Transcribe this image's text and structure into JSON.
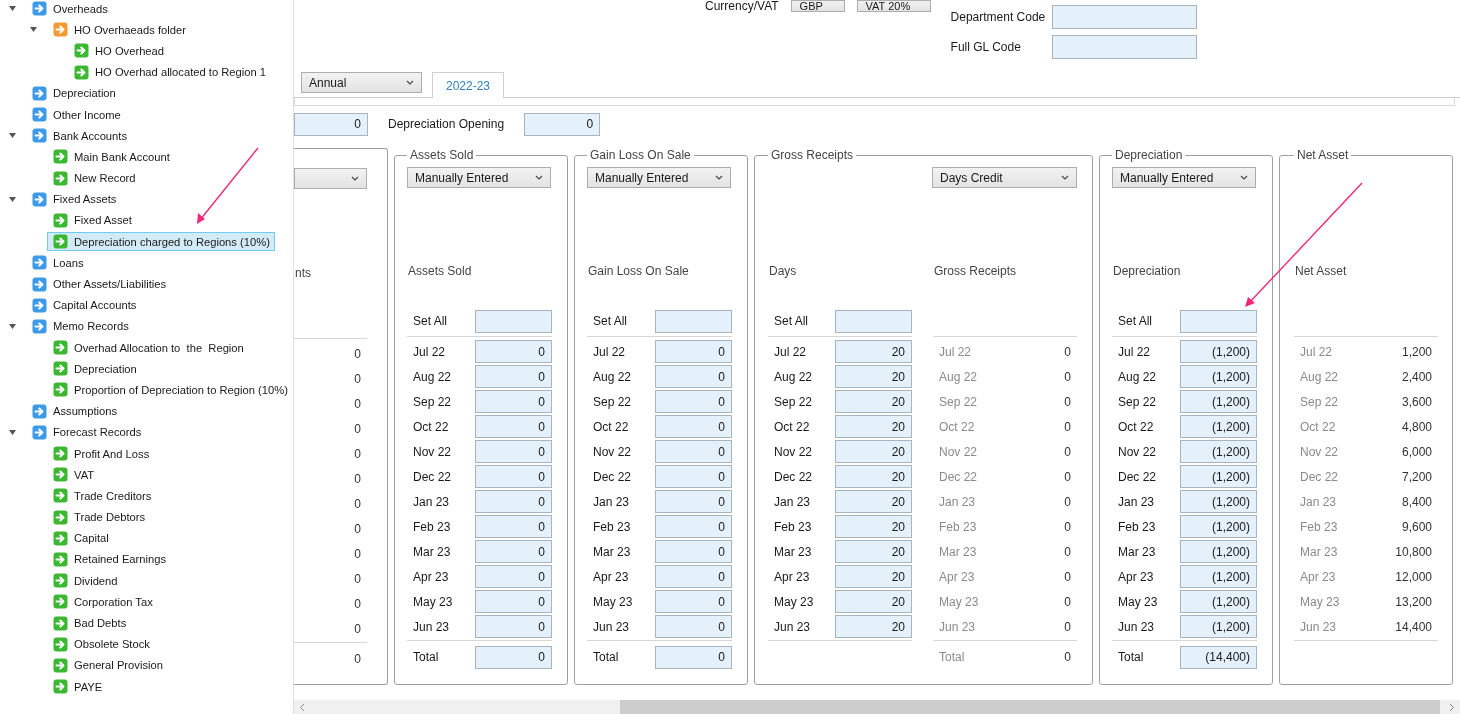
{
  "tree": [
    {
      "label": "Overheads",
      "kind": "group",
      "expanded": true,
      "selected": false,
      "children": [
        {
          "label": "HO Overhaeads folder",
          "kind": "folder",
          "expanded": true,
          "selected": false,
          "children": [
            {
              "label": "HO Overhead",
              "kind": "record",
              "selected": false
            },
            {
              "label": "HO Overhad allocated to Region 1",
              "kind": "record",
              "selected": false
            }
          ]
        }
      ]
    },
    {
      "label": "Depreciation",
      "kind": "group",
      "selected": false
    },
    {
      "label": "Other Income",
      "kind": "group",
      "selected": false
    },
    {
      "label": "Bank Accounts",
      "kind": "group",
      "expanded": true,
      "selected": false,
      "children": [
        {
          "label": "Main Bank Account",
          "kind": "record",
          "selected": false
        },
        {
          "label": "New Record",
          "kind": "record",
          "selected": false
        }
      ]
    },
    {
      "label": "Fixed Assets",
      "kind": "group",
      "expanded": true,
      "selected": false,
      "children": [
        {
          "label": "Fixed Asset",
          "kind": "record",
          "selected": false
        },
        {
          "label": "Depreciation charged to Regions (10%)",
          "kind": "record",
          "selected": true
        }
      ]
    },
    {
      "label": "Loans",
      "kind": "group",
      "selected": false
    },
    {
      "label": "Other Assets/Liabilities",
      "kind": "group",
      "selected": false
    },
    {
      "label": "Capital Accounts",
      "kind": "group",
      "selected": false
    },
    {
      "label": "Memo Records",
      "kind": "group",
      "expanded": true,
      "selected": false,
      "children": [
        {
          "label": "Overhad Allocation to  the  Region",
          "kind": "record",
          "selected": false
        },
        {
          "label": "Depreciation",
          "kind": "record",
          "selected": false
        },
        {
          "label": "Proportion of Depreciation to Region (10%)",
          "kind": "record",
          "selected": false
        }
      ]
    },
    {
      "label": "Assumptions",
      "kind": "group",
      "selected": false
    },
    {
      "label": "Forecast Records",
      "kind": "group",
      "expanded": true,
      "selected": false,
      "children": [
        {
          "label": "Profit And Loss",
          "kind": "record",
          "selected": false
        },
        {
          "label": "VAT",
          "kind": "record",
          "selected": false
        },
        {
          "label": "Trade Creditors",
          "kind": "record",
          "selected": false
        },
        {
          "label": "Trade Debtors",
          "kind": "record",
          "selected": false
        },
        {
          "label": "Capital",
          "kind": "record",
          "selected": false
        },
        {
          "label": "Retained Earnings",
          "kind": "record",
          "selected": false
        },
        {
          "label": "Dividend",
          "kind": "record",
          "selected": false
        },
        {
          "label": "Corporation Tax",
          "kind": "record",
          "selected": false
        },
        {
          "label": "Bad Debts",
          "kind": "record",
          "selected": false
        },
        {
          "label": "Obsolete Stock",
          "kind": "record",
          "selected": false
        },
        {
          "label": "General Provision",
          "kind": "record",
          "selected": false
        },
        {
          "label": "PAYE",
          "kind": "record",
          "selected": false
        }
      ]
    }
  ],
  "header": {
    "currency_label": "Currency/VAT",
    "currency": "GBP",
    "vat": "VAT 20%",
    "fields": [
      {
        "label": "Department Code"
      },
      {
        "label": "Full GL Code"
      }
    ]
  },
  "period": "Annual",
  "tabs": [
    {
      "label": "2022-23",
      "selected": true
    }
  ],
  "opening": {
    "first_value": "0",
    "label": "Depreciation Opening",
    "value": "0"
  },
  "panels": [
    {
      "kind": "cut",
      "heading": "nts",
      "rows": [
        {
          "value": "0"
        },
        {
          "value": "0"
        },
        {
          "value": "0"
        },
        {
          "value": "0"
        },
        {
          "value": "0"
        },
        {
          "value": "0"
        },
        {
          "value": "0"
        },
        {
          "value": "0"
        },
        {
          "value": "0"
        },
        {
          "value": "0"
        },
        {
          "value": "0"
        },
        {
          "value": "0"
        }
      ],
      "total": "0"
    },
    {
      "kind": "input",
      "title": "Assets Sold",
      "method": "Manually Entered",
      "heading": "Assets Sold",
      "set_all": "Set All",
      "rows": [
        {
          "month": "Jul 22",
          "value": "0"
        },
        {
          "month": "Aug 22",
          "value": "0"
        },
        {
          "month": "Sep 22",
          "value": "0"
        },
        {
          "month": "Oct 22",
          "value": "0"
        },
        {
          "month": "Nov 22",
          "value": "0"
        },
        {
          "month": "Dec 22",
          "value": "0"
        },
        {
          "month": "Jan 23",
          "value": "0"
        },
        {
          "month": "Feb 23",
          "value": "0"
        },
        {
          "month": "Mar 23",
          "value": "0"
        },
        {
          "month": "Apr 23",
          "value": "0"
        },
        {
          "month": "May 23",
          "value": "0"
        },
        {
          "month": "Jun 23",
          "value": "0"
        }
      ],
      "total_label": "Total",
      "total": "0"
    },
    {
      "kind": "input",
      "title": "Gain Loss On Sale",
      "method": "Manually Entered",
      "heading": "Gain Loss On Sale",
      "set_all": "Set All",
      "rows": [
        {
          "month": "Jul 22",
          "value": "0"
        },
        {
          "month": "Aug 22",
          "value": "0"
        },
        {
          "month": "Sep 22",
          "value": "0"
        },
        {
          "month": "Oct 22",
          "value": "0"
        },
        {
          "month": "Nov 22",
          "value": "0"
        },
        {
          "month": "Dec 22",
          "value": "0"
        },
        {
          "month": "Jan 23",
          "value": "0"
        },
        {
          "month": "Feb 23",
          "value": "0"
        },
        {
          "month": "Mar 23",
          "value": "0"
        },
        {
          "month": "Apr 23",
          "value": "0"
        },
        {
          "month": "May 23",
          "value": "0"
        },
        {
          "month": "Jun 23",
          "value": "0"
        }
      ],
      "total_label": "Total",
      "total": "0"
    },
    {
      "kind": "receipts",
      "title": "Gross Receipts",
      "method": "Days Credit",
      "days_heading": "Days",
      "heading": "Gross Receipts",
      "set_all": "Set All",
      "rows": [
        {
          "month": "Jul 22",
          "days": "20",
          "month_2": "Jul 22",
          "value": "0"
        },
        {
          "month": "Aug 22",
          "days": "20",
          "month_2": "Aug 22",
          "value": "0"
        },
        {
          "month": "Sep 22",
          "days": "20",
          "month_2": "Sep 22",
          "value": "0"
        },
        {
          "month": "Oct 22",
          "days": "20",
          "month_2": "Oct 22",
          "value": "0"
        },
        {
          "month": "Nov 22",
          "days": "20",
          "month_2": "Nov 22",
          "value": "0"
        },
        {
          "month": "Dec 22",
          "days": "20",
          "month_2": "Dec 22",
          "value": "0"
        },
        {
          "month": "Jan 23",
          "days": "20",
          "month_2": "Jan 23",
          "value": "0"
        },
        {
          "month": "Feb 23",
          "days": "20",
          "month_2": "Feb 23",
          "value": "0"
        },
        {
          "month": "Mar 23",
          "days": "20",
          "month_2": "Mar 23",
          "value": "0"
        },
        {
          "month": "Apr 23",
          "days": "20",
          "month_2": "Apr 23",
          "value": "0"
        },
        {
          "month": "May 23",
          "days": "20",
          "month_2": "May 23",
          "value": "0"
        },
        {
          "month": "Jun 23",
          "days": "20",
          "month_2": "Jun 23",
          "value": "0"
        }
      ],
      "total_label": "Total",
      "total": "0"
    },
    {
      "kind": "input",
      "title": "Depreciation",
      "method": "Manually Entered",
      "heading": "Depreciation",
      "set_all": "Set All",
      "rows": [
        {
          "month": "Jul 22",
          "value": "(1,200)"
        },
        {
          "month": "Aug 22",
          "value": "(1,200)"
        },
        {
          "month": "Sep 22",
          "value": "(1,200)"
        },
        {
          "month": "Oct 22",
          "value": "(1,200)"
        },
        {
          "month": "Nov 22",
          "value": "(1,200)"
        },
        {
          "month": "Dec 22",
          "value": "(1,200)"
        },
        {
          "month": "Jan 23",
          "value": "(1,200)"
        },
        {
          "month": "Feb 23",
          "value": "(1,200)"
        },
        {
          "month": "Mar 23",
          "value": "(1,200)"
        },
        {
          "month": "Apr 23",
          "value": "(1,200)"
        },
        {
          "month": "May 23",
          "value": "(1,200)"
        },
        {
          "month": "Jun 23",
          "value": "(1,200)"
        }
      ],
      "total_label": "Total",
      "total": "(14,400)"
    },
    {
      "kind": "readonly",
      "title": "Net Asset",
      "heading": "Net Asset",
      "rows": [
        {
          "month": "Jul 22",
          "value": "1,200"
        },
        {
          "month": "Aug 22",
          "value": "2,400"
        },
        {
          "month": "Sep 22",
          "value": "3,600"
        },
        {
          "month": "Oct 22",
          "value": "4,800"
        },
        {
          "month": "Nov 22",
          "value": "6,000"
        },
        {
          "month": "Dec 22",
          "value": "7,200"
        },
        {
          "month": "Jan 23",
          "value": "8,400"
        },
        {
          "month": "Feb 23",
          "value": "9,600"
        },
        {
          "month": "Mar 23",
          "value": "10,800"
        },
        {
          "month": "Apr 23",
          "value": "12,000"
        },
        {
          "month": "May 23",
          "value": "13,200"
        },
        {
          "month": "Jun 23",
          "value": "14,400"
        }
      ]
    }
  ]
}
